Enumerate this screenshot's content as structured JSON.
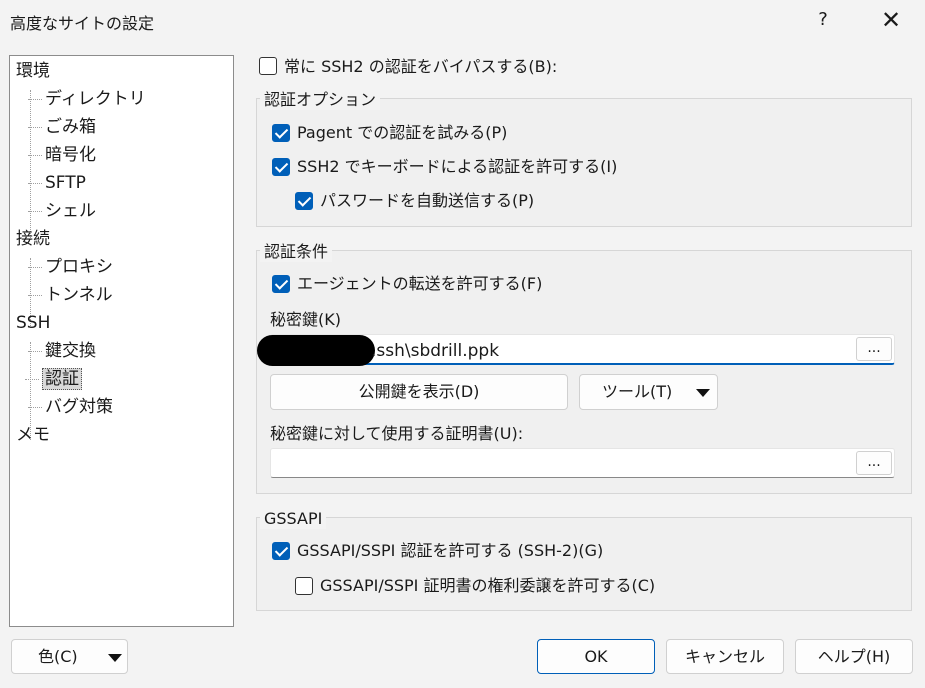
{
  "window": {
    "title": "高度なサイトの設定",
    "help": "?",
    "close": "✕"
  },
  "tree": {
    "items": [
      {
        "label": "環境",
        "level": 0
      },
      {
        "label": "ディレクトリ",
        "level": 1
      },
      {
        "label": "ごみ箱",
        "level": 1
      },
      {
        "label": "暗号化",
        "level": 1
      },
      {
        "label": "SFTP",
        "level": 1
      },
      {
        "label": "シェル",
        "level": 1
      },
      {
        "label": "接続",
        "level": 0
      },
      {
        "label": "プロキシ",
        "level": 1
      },
      {
        "label": "トンネル",
        "level": 1
      },
      {
        "label": "SSH",
        "level": 0
      },
      {
        "label": "鍵交換",
        "level": 1
      },
      {
        "label": "認証",
        "level": 1,
        "selected": true
      },
      {
        "label": "バグ対策",
        "level": 1
      },
      {
        "label": "メモ",
        "level": 0
      }
    ]
  },
  "bypass": {
    "label": "常に SSH2 の認証をバイパスする(B):",
    "checked": false
  },
  "auth_options": {
    "title": "認証オプション",
    "pagent": {
      "label": "Pagent での認証を試みる(P)",
      "checked": true
    },
    "keyboard": {
      "label": "SSH2 でキーボードによる認証を許可する(I)",
      "checked": true
    },
    "password": {
      "label": "パスワードを自動送信する(P)",
      "checked": true
    }
  },
  "auth_conditions": {
    "title": "認証条件",
    "agent_forward": {
      "label": "エージェントの転送を許可する(F)",
      "checked": true
    },
    "private_key_label": "秘密鍵(K)",
    "private_key_value": ".ssh\\sbdrill.ppk",
    "browse": "...",
    "show_public_key": "公開鍵を表示(D)",
    "tools": "ツール(T)",
    "cert_label": "秘密鍵に対して使用する証明書(U):",
    "cert_value": "",
    "cert_browse": "..."
  },
  "gssapi": {
    "title": "GSSAPI",
    "allow": {
      "label": "GSSAPI/SSPI 認証を許可する (SSH-2)(G)",
      "checked": true
    },
    "delegate": {
      "label": "GSSAPI/SSPI 証明書の権利委譲を許可する(C)",
      "checked": false
    }
  },
  "footer": {
    "color": "色(C)",
    "ok": "OK",
    "cancel": "キャンセル",
    "help": "ヘルプ(H)"
  }
}
